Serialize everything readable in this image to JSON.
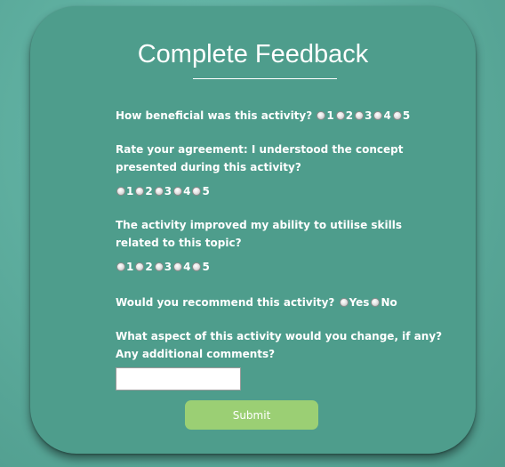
{
  "form": {
    "title": "Complete Feedback",
    "q1": {
      "text": "How beneficial was this activity?",
      "options": [
        "1",
        "2",
        "3",
        "4",
        "5"
      ]
    },
    "q2": {
      "text": "Rate your agreement: I understood the concept presented during this activity?",
      "options": [
        "1",
        "2",
        "3",
        "4",
        "5"
      ]
    },
    "q3": {
      "text": "The activity improved my ability to utilise skills related to this topic?",
      "options": [
        "1",
        "2",
        "3",
        "4",
        "5"
      ]
    },
    "q4": {
      "text": "Would you recommend this activity?",
      "options": [
        "Yes",
        "No"
      ]
    },
    "q5": {
      "text": "What aspect of this activity would you change, if any? Any additional comments?",
      "value": ""
    },
    "submit_label": "Submit"
  }
}
